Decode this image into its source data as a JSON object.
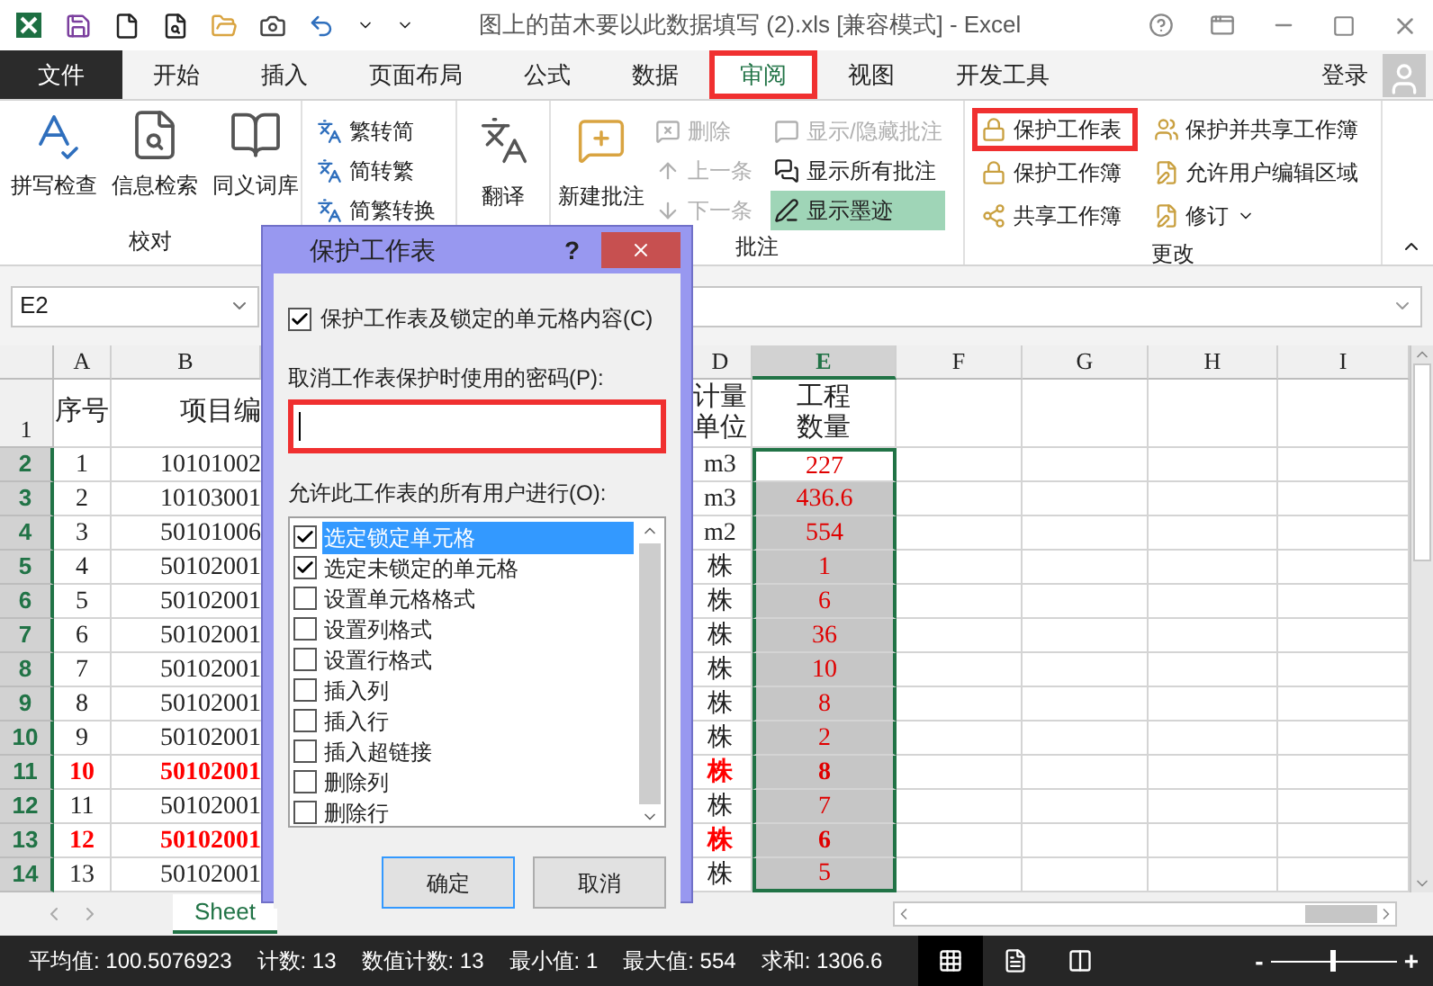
{
  "title_bar": {
    "title": "图上的苗木要以此数据填写 (2).xls  [兼容模式] - Excel"
  },
  "ribbon_tabs": [
    {
      "label": "文件",
      "kind": "file",
      "selected": false,
      "highlighted": false
    },
    {
      "label": "开始",
      "kind": "tab",
      "selected": false,
      "highlighted": false
    },
    {
      "label": "插入",
      "kind": "tab",
      "selected": false,
      "highlighted": false
    },
    {
      "label": "页面布局",
      "kind": "tab",
      "selected": false,
      "highlighted": false
    },
    {
      "label": "公式",
      "kind": "tab",
      "selected": false,
      "highlighted": false
    },
    {
      "label": "数据",
      "kind": "tab",
      "selected": false,
      "highlighted": false
    },
    {
      "label": "审阅",
      "kind": "tab",
      "selected": true,
      "highlighted": true
    },
    {
      "label": "视图",
      "kind": "tab",
      "selected": false,
      "highlighted": false
    },
    {
      "label": "开发工具",
      "kind": "tab",
      "selected": false,
      "highlighted": false
    }
  ],
  "account": {
    "label": "登录"
  },
  "ribbon": {
    "proofing": {
      "label": "校对",
      "buttons": [
        "拼写检查",
        "信息检索",
        "同义词库"
      ]
    },
    "chinese_conversion": {
      "buttons": [
        "繁转简",
        "简转繁",
        "简繁转换"
      ]
    },
    "translate": {
      "buttons": [
        "翻译"
      ]
    },
    "comments": {
      "label": "批注",
      "new_comment": "新建批注",
      "actions": [
        {
          "label": "删除",
          "disabled": true,
          "on": false
        },
        {
          "label": "上一条",
          "disabled": true,
          "on": false
        },
        {
          "label": "下一条",
          "disabled": true,
          "on": false
        },
        {
          "label": "显示/隐藏批注",
          "disabled": true,
          "on": false
        },
        {
          "label": "显示所有批注",
          "disabled": false,
          "on": false
        },
        {
          "label": "显示墨迹",
          "disabled": false,
          "on": true
        }
      ]
    },
    "changes": {
      "label": "更改",
      "actions": [
        {
          "label": "保护工作表",
          "highlighted": true,
          "dropdown": false
        },
        {
          "label": "保护工作簿",
          "highlighted": false,
          "dropdown": false
        },
        {
          "label": "共享工作簿",
          "highlighted": false,
          "dropdown": false
        },
        {
          "label": "保护并共享工作簿",
          "highlighted": false,
          "dropdown": false
        },
        {
          "label": "允许用户编辑区域",
          "highlighted": false,
          "dropdown": false
        },
        {
          "label": "修订",
          "highlighted": false,
          "dropdown": true
        }
      ]
    }
  },
  "formula_bar": {
    "name_box": "E2"
  },
  "sheet": {
    "columns": [
      {
        "label": "A",
        "selected": false
      },
      {
        "label": "B",
        "selected": false
      },
      {
        "label": "D",
        "selected": false
      },
      {
        "label": "E",
        "selected": true
      },
      {
        "label": "F",
        "selected": false
      },
      {
        "label": "G",
        "selected": false
      },
      {
        "label": "H",
        "selected": false
      },
      {
        "label": "I",
        "selected": false
      }
    ],
    "header_row": {
      "row_number": "1",
      "seq": "序号",
      "code": "项目编",
      "unit": "计量单位",
      "quantity": "工程数量"
    },
    "rows": [
      {
        "row_number": "2",
        "selected": true,
        "active": true,
        "seq": "1",
        "code": "10101002",
        "unit": "m3",
        "quantity": "227",
        "emphasis": false
      },
      {
        "row_number": "3",
        "selected": true,
        "active": false,
        "seq": "2",
        "code": "10103001",
        "unit": "m3",
        "quantity": "436.6",
        "emphasis": false
      },
      {
        "row_number": "4",
        "selected": true,
        "active": false,
        "seq": "3",
        "code": "50101006",
        "unit": "m2",
        "quantity": "554",
        "emphasis": false
      },
      {
        "row_number": "5",
        "selected": true,
        "active": false,
        "seq": "4",
        "code": "50102001",
        "unit": "株",
        "quantity": "1",
        "emphasis": false
      },
      {
        "row_number": "6",
        "selected": true,
        "active": false,
        "seq": "5",
        "code": "50102001",
        "unit": "株",
        "quantity": "6",
        "emphasis": false
      },
      {
        "row_number": "7",
        "selected": true,
        "active": false,
        "seq": "6",
        "code": "50102001",
        "unit": "株",
        "quantity": "36",
        "emphasis": false
      },
      {
        "row_number": "8",
        "selected": true,
        "active": false,
        "seq": "7",
        "code": "50102001",
        "unit": "株",
        "quantity": "10",
        "emphasis": false
      },
      {
        "row_number": "9",
        "selected": true,
        "active": false,
        "seq": "8",
        "code": "50102001",
        "unit": "株",
        "quantity": "8",
        "emphasis": false
      },
      {
        "row_number": "10",
        "selected": true,
        "active": false,
        "seq": "9",
        "code": "50102001",
        "unit": "株",
        "quantity": "2",
        "emphasis": false
      },
      {
        "row_number": "11",
        "selected": true,
        "active": false,
        "seq": "10",
        "code": "50102001",
        "unit": "株",
        "quantity": "8",
        "emphasis": true
      },
      {
        "row_number": "12",
        "selected": true,
        "active": false,
        "seq": "11",
        "code": "50102001",
        "unit": "株",
        "quantity": "7",
        "emphasis": false
      },
      {
        "row_number": "13",
        "selected": true,
        "active": false,
        "seq": "12",
        "code": "50102001",
        "unit": "株",
        "quantity": "6",
        "emphasis": true
      },
      {
        "row_number": "14",
        "selected": true,
        "active": false,
        "seq": "13",
        "code": "50102001",
        "unit": "株",
        "quantity": "5",
        "emphasis": false
      }
    ]
  },
  "sheet_tabs": [
    {
      "label": "Sheet",
      "selected": true
    }
  ],
  "status_bar": {
    "stats": [
      "平均值: 100.5076923",
      "计数: 13",
      "数值计数: 13",
      "最小值: 1",
      "最大值: 554",
      "求和: 1306.6"
    ],
    "views": [
      {
        "kind": "normal",
        "selected": true
      },
      {
        "kind": "page_layout",
        "selected": false
      },
      {
        "kind": "page_break",
        "selected": false
      }
    ],
    "zoom": {
      "minus": "-",
      "plus": "+",
      "level": 0.5
    }
  },
  "dialog": {
    "title": "保护工作表",
    "help": "?",
    "protect_checkbox": {
      "label": "保护工作表及锁定的单元格内容(C)",
      "checked": true
    },
    "password_label": "取消工作表保护时使用的密码(P):",
    "password_field": {
      "highlighted": true
    },
    "permissions_label": "允许此工作表的所有用户进行(O):",
    "permissions": [
      {
        "label": "选定锁定单元格",
        "checked": true,
        "selected": true
      },
      {
        "label": "选定未锁定的单元格",
        "checked": true,
        "selected": false
      },
      {
        "label": "设置单元格格式",
        "checked": false,
        "selected": false
      },
      {
        "label": "设置列格式",
        "checked": false,
        "selected": false
      },
      {
        "label": "设置行格式",
        "checked": false,
        "selected": false
      },
      {
        "label": "插入列",
        "checked": false,
        "selected": false
      },
      {
        "label": "插入行",
        "checked": false,
        "selected": false
      },
      {
        "label": "插入超链接",
        "checked": false,
        "selected": false
      },
      {
        "label": "删除列",
        "checked": false,
        "selected": false
      },
      {
        "label": "删除行",
        "checked": false,
        "selected": false
      }
    ],
    "buttons": [
      {
        "label": "确定",
        "kind": "default"
      },
      {
        "label": "取消",
        "kind": "normal"
      }
    ]
  }
}
